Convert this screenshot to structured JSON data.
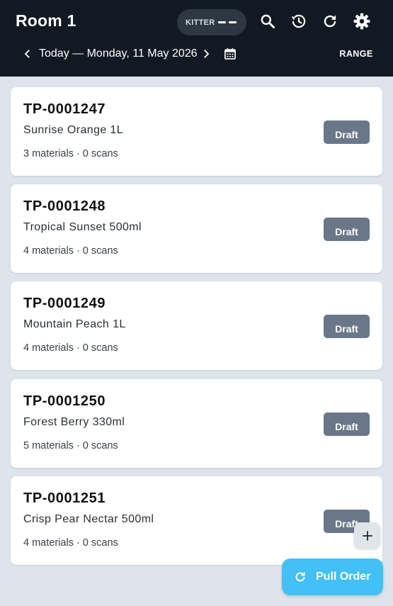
{
  "header": {
    "title": "Room 1",
    "kitter_label": "KITTER",
    "date_label": "Today — Monday, 11 May 2026",
    "range_label": "RANGE",
    "icons": [
      "search-icon",
      "history-icon",
      "refresh-icon",
      "settings-icon",
      "chevron-left-icon",
      "chevron-right-icon",
      "calendar-icon"
    ]
  },
  "orders": [
    {
      "code": "TP-0001247",
      "product": "Sunrise Orange 1L",
      "meta": "3 materials · 0 scans",
      "status": "Draft"
    },
    {
      "code": "TP-0001248",
      "product": "Tropical Sunset 500ml",
      "meta": "4 materials · 0 scans",
      "status": "Draft"
    },
    {
      "code": "TP-0001249",
      "product": "Mountain Peach 1L",
      "meta": "4 materials · 0 scans",
      "status": "Draft"
    },
    {
      "code": "TP-0001250",
      "product": "Forest Berry 330ml",
      "meta": "5 materials · 0 scans",
      "status": "Draft"
    },
    {
      "code": "TP-0001251",
      "product": "Crisp Pear Nectar 500ml",
      "meta": "4 materials · 0 scans",
      "status": "Draft"
    }
  ],
  "fab": {
    "add_icon": "plus-icon",
    "pull_label": "Pull Order",
    "pull_icon": "refresh-icon"
  },
  "colors": {
    "appbar": "#111922",
    "background": "#dde4ec",
    "draft_badge": "#6a7789",
    "accent": "#43c0f5"
  }
}
